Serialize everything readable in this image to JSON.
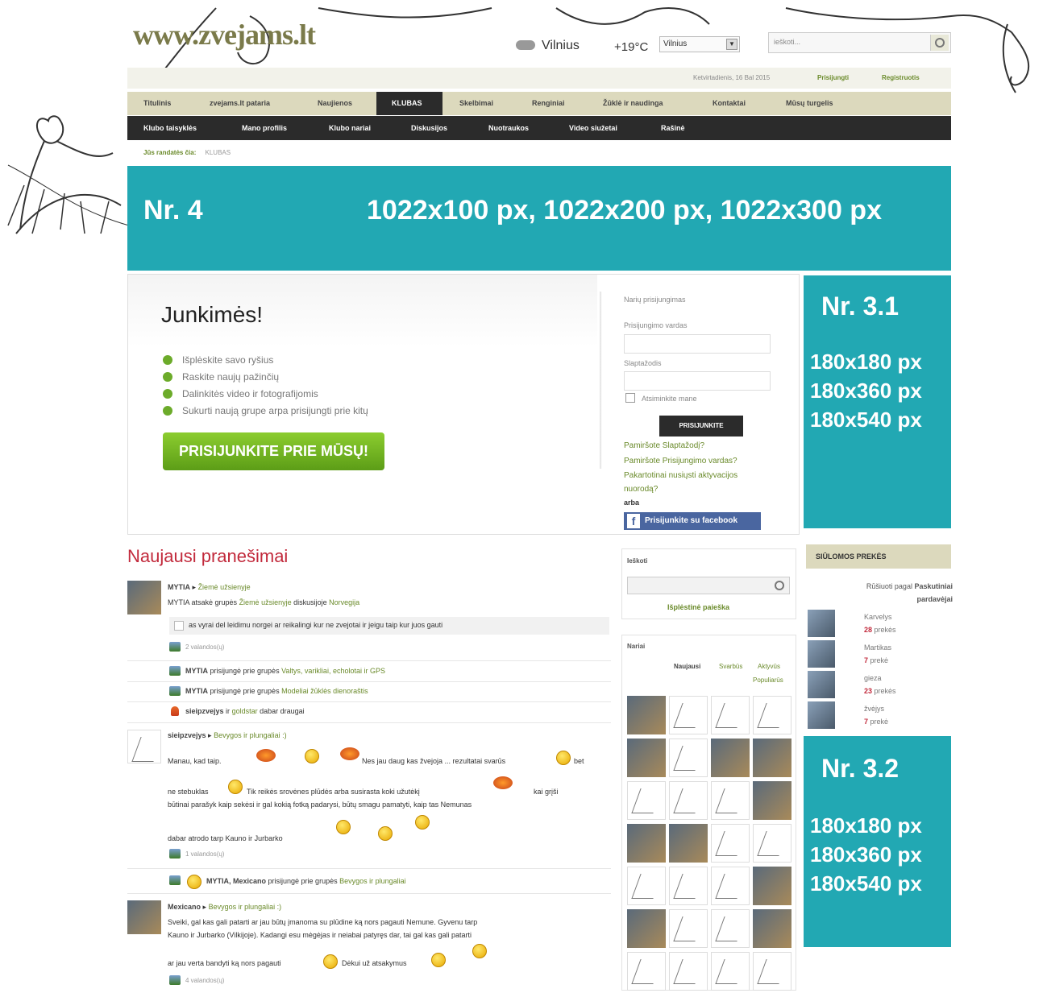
{
  "site": {
    "logo": "www.zvejams.lt"
  },
  "weather": {
    "city": "Vilnius",
    "temp": "+19°C",
    "select_value": "Vilnius"
  },
  "search_top": {
    "placeholder": "ieškoti..."
  },
  "userbar": {
    "date": "Ketvirtadienis, 16 Bal 2015",
    "login": "Prisijungti",
    "register": "Registruotis"
  },
  "main_nav": [
    "Titulinis",
    "zvejams.lt pataria",
    "Naujienos",
    "KLUBAS",
    "Skelbimai",
    "Renginiai",
    "Žūklė ir naudinga",
    "Kontaktai",
    "Mūsų turgelis"
  ],
  "sub_nav": [
    "Klubo taisyklės",
    "Mano profilis",
    "Klubo nariai",
    "Diskusijos",
    "Nuotraukos",
    "Video siužetai",
    "Rašinė"
  ],
  "breadcrumb": {
    "prefix": "Jūs randatės čia:",
    "current": "KLUBAS"
  },
  "banner_top": {
    "label": "Nr. 4",
    "sizes": "1022x100 px, 1022x200 px, 1022x300 px"
  },
  "join": {
    "title": "Junkimės!",
    "bullets": [
      "Išplėskite savo ryšius",
      "Raskite naujų pažinčių",
      "Dalinkitės video ir fotografijomis",
      "Sukurti naują grupe arpa prisijungti prie kitų"
    ],
    "button": "PRISIJUNKITE PRIE MŪSŲ!"
  },
  "login_panel": {
    "heading": "Narių prisijungimas",
    "username_label": "Prisijungimo vardas",
    "password_label": "Slaptažodis",
    "remember": "Atsiminkite mane",
    "submit": "PRISIJUNKITE",
    "forgot_password": "Pamiršote Slaptažodį?",
    "forgot_username": "Pamiršote Prisijungimo vardas?",
    "resend1": "Pakartotinai nusiųsti aktyvacijos",
    "resend2": "nuorodą?",
    "or": "arba",
    "facebook": "Prisijunkite su facebook"
  },
  "ad_31": {
    "label": "Nr. 3.1",
    "sizes": [
      "180x180 px",
      "180x360 px",
      "180x540 px"
    ]
  },
  "ad_32": {
    "label": "Nr. 3.2",
    "sizes": [
      "180x180 px",
      "180x360 px",
      "180x540 px"
    ]
  },
  "news": {
    "title": "Naujausi pranešimai",
    "items": [
      {
        "user": "MYTIA",
        "arrow": "▸",
        "group": "Žiemė užsienyje",
        "text_a": "MYTIA atsakė grupės",
        "text_b": "Žiemė užsienyje",
        "text_c": "diskusijoje",
        "text_d": "Norvegija"
      },
      {
        "quote": "as vyrai del leidimu norgei ar reikalingi kur ne zvejotai ir jeigu taip kur juos gauti"
      },
      {
        "ago": "2 valandos(ų)"
      },
      {
        "user": "MYTIA",
        "text": "prisijungė prie grupės",
        "group": "Valtys, varikliai, echolotai ir GPS"
      },
      {
        "user": "MYTIA",
        "text": "prisijungė prie grupės",
        "group": "Modeliai žūklės dienoraštis"
      },
      {
        "user": "sieipzvejys",
        "text_a": "ir",
        "friend": "goldstar",
        "text_b": "dabar draugai"
      },
      {
        "user": "sieipzvejys",
        "arrow": "▸",
        "group": "Bevygos ir plungaliai :)"
      },
      {
        "msg1": "Manau, kad taip.",
        "msg2": "Nes jau daug kas žvejoja ... rezultatai svarūs",
        "msg3": "bet"
      },
      {
        "msg1": "ne stebuklas",
        "msg2": "Tik reikės srovėnes plūdės arba susirasta koki užutėkį",
        "msg3": "kai grįši"
      },
      {
        "msg": "būtinai parašyk kaip sekėsi ir gal kokią fotką padarysi, būtų smagu pamatyti, kaip tas Nemunas"
      },
      {
        "msg": "dabar atrodo tarp Kauno ir Jurbarko"
      },
      {
        "ago": "1 valandos(ų)"
      },
      {
        "users": "MYTIA, Mexicano",
        "text": "prisijungė prie grupės",
        "group": "Bevygos ir plungaliai"
      },
      {
        "user": "Mexicano",
        "arrow": "▸",
        "group": "Bevygos ir plungaliai :)"
      },
      {
        "msg": "Sveiki, gal kas gali patarti ar jau būtų įmanoma su plūdine ką nors pagauti Nemune. Gyvenu tarp"
      },
      {
        "msg": "Kauno ir Jurbarko (Vilkijoje). Kadangi esu mėgėjas ir neiabai patyręs dar, tai gal kas gali patarti"
      },
      {
        "msg1": "ar jau verta bandyti ką nors pagauti",
        "msg2": "Dėkui už atsakymus"
      },
      {
        "ago": "4 valandos(ų)"
      }
    ]
  },
  "side_search": {
    "title": "Ieškoti",
    "advanced": "Išplėstinė paieška"
  },
  "members": {
    "title": "Nariai",
    "tabs": [
      "Naujausi",
      "Svarbūs",
      "Aktyvūs",
      "Populiarūs"
    ]
  },
  "products": {
    "title": "SIŪLOMOS PREKĖS",
    "sort_a": "Rūšiuoti pagal",
    "sort_b": "Paskutiniai",
    "sort_c": "pardavėjai",
    "items": [
      {
        "name": "Karvelys",
        "count": "28",
        "unit": "prekės"
      },
      {
        "name": "Martikas",
        "count": "7",
        "unit": "prekė"
      },
      {
        "name": "gieza",
        "count": "23",
        "unit": "prekės"
      },
      {
        "name": "žvėjys",
        "count": "7",
        "unit": "prekė"
      }
    ]
  }
}
